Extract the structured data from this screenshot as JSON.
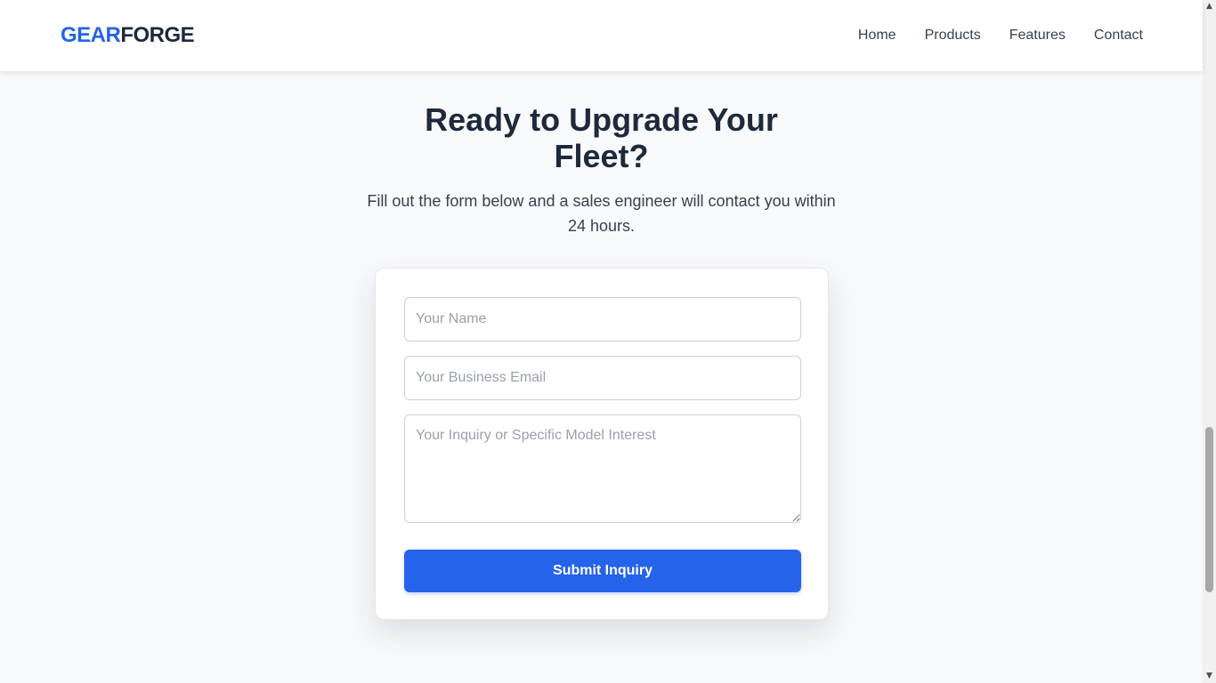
{
  "header": {
    "logo_part_a": "GEAR",
    "logo_part_b": "FORGE",
    "nav": [
      "Home",
      "Products",
      "Features",
      "Contact"
    ]
  },
  "hero": {
    "title": "Ready to Upgrade Your Fleet?",
    "subtitle": "Fill out the form below and a sales engineer will contact you within 24 hours."
  },
  "form": {
    "name_placeholder": "Your Name",
    "email_placeholder": "Your Business Email",
    "message_placeholder": "Your Inquiry or Specific Model Interest",
    "name_value": "",
    "email_value": "",
    "message_value": "",
    "submit_label": "Submit Inquiry"
  },
  "scrollbar": {
    "up_icon": "triangle-up",
    "down_icon": "triangle-down"
  },
  "colors": {
    "accent": "#2563eb",
    "heading": "#1e293b",
    "background": "#f8f9fb"
  }
}
